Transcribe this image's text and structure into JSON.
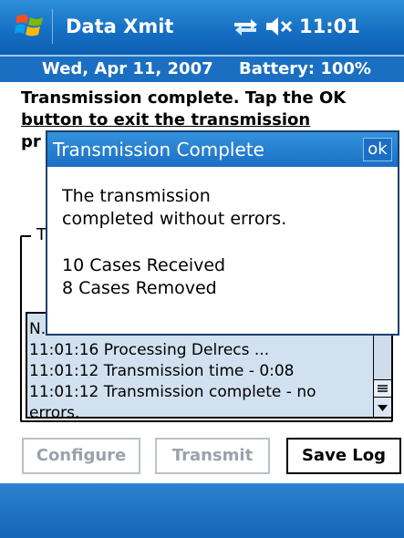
{
  "titlebar": {
    "start_icon": "windows-flag-icon",
    "app_title": "Data Xmit",
    "connectivity_icon": "connectivity-arrows-icon",
    "volume_icon": "speaker-muted-icon",
    "time": "11:01"
  },
  "status": {
    "date": "Wed, Apr 11, 2007",
    "battery": "Battery: 100%"
  },
  "instruction": {
    "line1": "Transmission complete. Tap the OK",
    "line2": "button to exit the transmission",
    "line3": "pr"
  },
  "group": {
    "label_partial": "T"
  },
  "log": {
    "lines": [
      "N...",
      "11:01:16 Processing Delrecs ...",
      "11:01:12 Transmission time - 0:08",
      "11:01:12 Transmission complete - no errors."
    ]
  },
  "buttons": {
    "configure": "Configure",
    "transmit": "Transmit",
    "save_log": "Save Log"
  },
  "dialog": {
    "title": "Transmission Complete",
    "ok": "ok",
    "line1": "The transmission",
    "line2": "completed without errors.",
    "line3": "10 Cases Received",
    "line4": "8 Cases Removed"
  },
  "colors": {
    "title_blue": "#1670c4",
    "list_background": "#d1e1ef",
    "disabled_text": "#9aa3ab"
  }
}
